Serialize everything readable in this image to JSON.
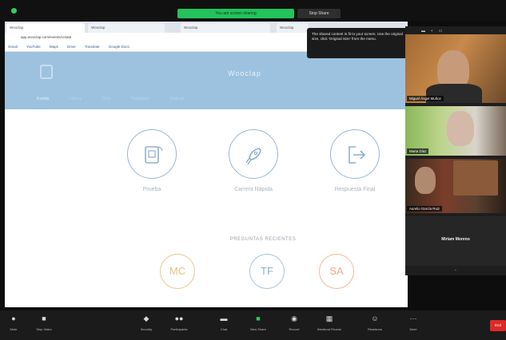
{
  "zoom": {
    "share_banner": "You are screen sharing",
    "stop_share": "Stop Share"
  },
  "browser": {
    "tabs": [
      {
        "label": "Wooclap"
      },
      {
        "label": "Wooclap"
      },
      {
        "label": "Wooclap"
      },
      {
        "label": "Wooclap"
      }
    ],
    "address": "app.wooclap.com/events/create",
    "bookmarks": [
      "Gmail",
      "YouTube",
      "Maps",
      "Drive",
      "Translate",
      "Google Docs"
    ]
  },
  "site": {
    "title": "Wooclap",
    "nav": [
      {
        "label": "Events"
      },
      {
        "label": "Library"
      },
      {
        "label": "Stats"
      },
      {
        "label": "Templates"
      },
      {
        "label": "Settings"
      }
    ],
    "cards": [
      {
        "label": "Prueba",
        "icon": "tablet-icon"
      },
      {
        "label": "Carrera Rápida",
        "icon": "rocket-icon"
      },
      {
        "label": "Respuesta Final",
        "icon": "exit-door-icon"
      }
    ],
    "recent_title": "PREGUNTAS RECIENTES",
    "recent": [
      "MC",
      "TF",
      "SA"
    ]
  },
  "tooltip": {
    "text": "The shared content is fit to your screen. Use the original size, click 'Original Size' from the menu."
  },
  "participants": [
    {
      "name": "Miguel Ángel Muñoz"
    },
    {
      "name": "Marta Díaz"
    },
    {
      "name": "Aurelio García Ruiz"
    },
    {
      "name": "Miriam Moreno"
    }
  ],
  "toolbar": {
    "items": [
      {
        "label": "Mute",
        "icon": "mic-icon"
      },
      {
        "label": "Stop Video",
        "icon": "camera-icon"
      },
      {
        "label": "Security",
        "icon": "shield-icon"
      },
      {
        "label": "Participants",
        "icon": "people-icon"
      },
      {
        "label": "Chat",
        "icon": "chat-icon"
      },
      {
        "label": "New Share",
        "icon": "share-icon"
      },
      {
        "label": "Record",
        "icon": "record-icon"
      },
      {
        "label": "Breakout Rooms",
        "icon": "grid-icon"
      },
      {
        "label": "Reactions",
        "icon": "emoji-icon"
      },
      {
        "label": "More",
        "icon": "ellipsis-icon"
      }
    ],
    "end": "End"
  },
  "colors": {
    "accent_green": "#2bd35a",
    "site_header": "#9cc2e0",
    "end_red": "#e02828"
  }
}
